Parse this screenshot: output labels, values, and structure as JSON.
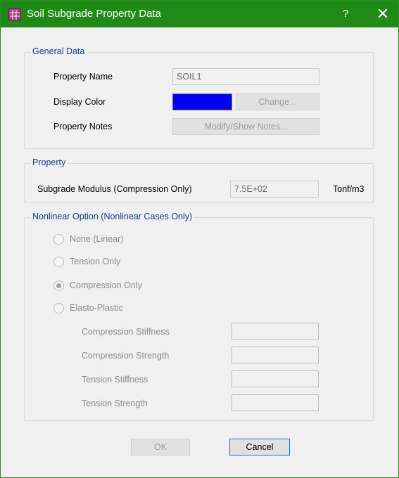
{
  "window": {
    "title": "Soil Subgrade Property Data",
    "help_label": "?",
    "close_label": "✕",
    "accent": "#1f8a16"
  },
  "general": {
    "group_label": "General Data",
    "name_label": "Property Name",
    "name_value": "SOIL1",
    "color_label": "Display Color",
    "color_value": "#0000f6",
    "change_label": "Change...",
    "notes_label": "Property Notes",
    "notes_button": "Modify/Show Notes..."
  },
  "property": {
    "group_label": "Property",
    "modulus_label": "Subgrade Modulus  (Compression Only)",
    "modulus_value": "7.5E+02",
    "modulus_unit": "Tonf/m3"
  },
  "nonlinear": {
    "group_label": "Nonlinear Option  (Nonlinear Cases Only)",
    "options": [
      {
        "label": "None (Linear)",
        "checked": false
      },
      {
        "label": "Tension Only",
        "checked": false
      },
      {
        "label": "Compression Only",
        "checked": true
      },
      {
        "label": "Elasto-Plastic",
        "checked": false
      }
    ],
    "fields": [
      {
        "label": "Compression Stiffness",
        "value": ""
      },
      {
        "label": "Compression Strength",
        "value": ""
      },
      {
        "label": "Tension Stiffness",
        "value": ""
      },
      {
        "label": "Tension Strength",
        "value": ""
      }
    ]
  },
  "buttons": {
    "ok_label": "OK",
    "cancel_label": "Cancel"
  }
}
